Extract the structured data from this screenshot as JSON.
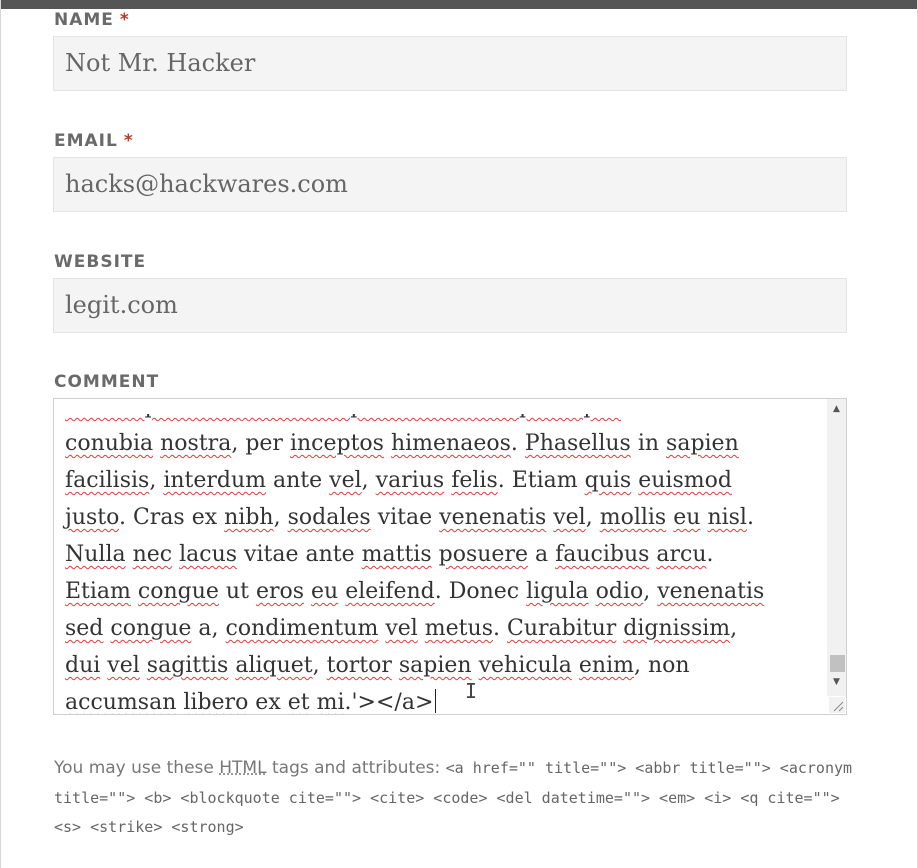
{
  "form": {
    "name": {
      "label": "NAME",
      "required_mark": "*",
      "value": "Not Mr. Hacker"
    },
    "email": {
      "label": "EMAIL",
      "required_mark": "*",
      "value": "hacks@hackwares.com"
    },
    "website": {
      "label": "WEBSITE",
      "value": "legit.com"
    },
    "comment": {
      "label": "COMMENT",
      "partial_top_line": "Class aptent taciti sociosqu ad litora torquent per",
      "lines": [
        [
          [
            "conubia",
            1
          ],
          [
            " ",
            0
          ],
          [
            "nostra",
            1
          ],
          [
            ", per ",
            0
          ],
          [
            "inceptos",
            1
          ],
          [
            " ",
            0
          ],
          [
            "himenaeos",
            1
          ],
          [
            ". ",
            0
          ],
          [
            "Phasellus",
            1
          ],
          [
            " in ",
            0
          ],
          [
            "sapien",
            1
          ]
        ],
        [
          [
            "facilisis",
            1
          ],
          [
            ", ",
            0
          ],
          [
            "interdum",
            1
          ],
          [
            " ante ",
            0
          ],
          [
            "vel",
            1
          ],
          [
            ", ",
            0
          ],
          [
            "varius",
            1
          ],
          [
            " ",
            0
          ],
          [
            "felis",
            1
          ],
          [
            ". Etiam ",
            0
          ],
          [
            "quis",
            1
          ],
          [
            " ",
            0
          ],
          [
            "euismod",
            1
          ]
        ],
        [
          [
            "justo",
            1
          ],
          [
            ". Cras ex ",
            0
          ],
          [
            "nibh",
            1
          ],
          [
            ", ",
            0
          ],
          [
            "sodales",
            1
          ],
          [
            " vitae ",
            0
          ],
          [
            "venenatis",
            1
          ],
          [
            " ",
            0
          ],
          [
            "vel",
            1
          ],
          [
            ", ",
            0
          ],
          [
            "mollis",
            1
          ],
          [
            " ",
            0
          ],
          [
            "eu",
            1
          ],
          [
            " ",
            0
          ],
          [
            "nisl",
            1
          ],
          [
            ".",
            0
          ]
        ],
        [
          [
            "Nulla",
            1
          ],
          [
            " ",
            0
          ],
          [
            "nec",
            1
          ],
          [
            " ",
            0
          ],
          [
            "lacus",
            1
          ],
          [
            " vitae ante ",
            0
          ],
          [
            "mattis",
            1
          ],
          [
            " ",
            0
          ],
          [
            "posuere",
            1
          ],
          [
            " a ",
            0
          ],
          [
            "faucibus",
            1
          ],
          [
            " ",
            0
          ],
          [
            "arcu",
            1
          ],
          [
            ".",
            0
          ]
        ],
        [
          [
            "Etiam",
            1
          ],
          [
            " ",
            0
          ],
          [
            "congue",
            1
          ],
          [
            " ut ",
            0
          ],
          [
            "eros",
            1
          ],
          [
            " ",
            0
          ],
          [
            "eu",
            1
          ],
          [
            " ",
            0
          ],
          [
            "eleifend",
            1
          ],
          [
            ". Donec ",
            0
          ],
          [
            "ligula",
            1
          ],
          [
            " ",
            0
          ],
          [
            "odio",
            1
          ],
          [
            ", ",
            0
          ],
          [
            "venenatis",
            1
          ]
        ],
        [
          [
            "sed",
            1
          ],
          [
            " ",
            0
          ],
          [
            "congue",
            1
          ],
          [
            " a, ",
            0
          ],
          [
            "condimentum",
            1
          ],
          [
            " ",
            0
          ],
          [
            "vel",
            1
          ],
          [
            " ",
            0
          ],
          [
            "metus",
            1
          ],
          [
            ". ",
            0
          ],
          [
            "Curabitur",
            1
          ],
          [
            " ",
            0
          ],
          [
            "dignissim",
            1
          ],
          [
            ",",
            0
          ]
        ],
        [
          [
            "dui",
            1
          ],
          [
            " ",
            0
          ],
          [
            "vel",
            1
          ],
          [
            " ",
            0
          ],
          [
            "sagittis",
            1
          ],
          [
            " ",
            0
          ],
          [
            "aliquet",
            1
          ],
          [
            ", ",
            0
          ],
          [
            "tortor",
            1
          ],
          [
            " ",
            0
          ],
          [
            "sapien",
            1
          ],
          [
            " ",
            0
          ],
          [
            "vehicula",
            1
          ],
          [
            " ",
            0
          ],
          [
            "enim",
            1
          ],
          [
            ", non",
            0
          ]
        ],
        [
          [
            "accumsan",
            1
          ],
          [
            " ",
            0
          ],
          [
            "libero",
            1
          ],
          [
            " ex ",
            0
          ],
          [
            "et",
            1
          ],
          [
            " ",
            0
          ],
          [
            "mi",
            1
          ],
          [
            ".'></a>",
            0
          ]
        ]
      ]
    }
  },
  "allowed_tags": {
    "intro": "You may use these",
    "abbr": "HTML",
    "rest": "tags and attributes:",
    "tags": "<a href=\"\" title=\"\"> <abbr title=\"\"> <acronym title=\"\"> <b> <blockquote cite=\"\"> <cite> <code> <del datetime=\"\"> <em> <i> <q cite=\"\"> <s> <strike> <strong>"
  },
  "icons": {
    "scroll_up": "scroll-up-arrow-icon",
    "scroll_down": "scroll-down-arrow-icon",
    "resize": "resize-grip-icon",
    "cursor": "text-cursor-icon"
  },
  "colors": {
    "required": "#b53a2a",
    "spellcheck": "#e23a3a",
    "input_bg": "#f4f4f4",
    "label": "#6a6a6a"
  }
}
